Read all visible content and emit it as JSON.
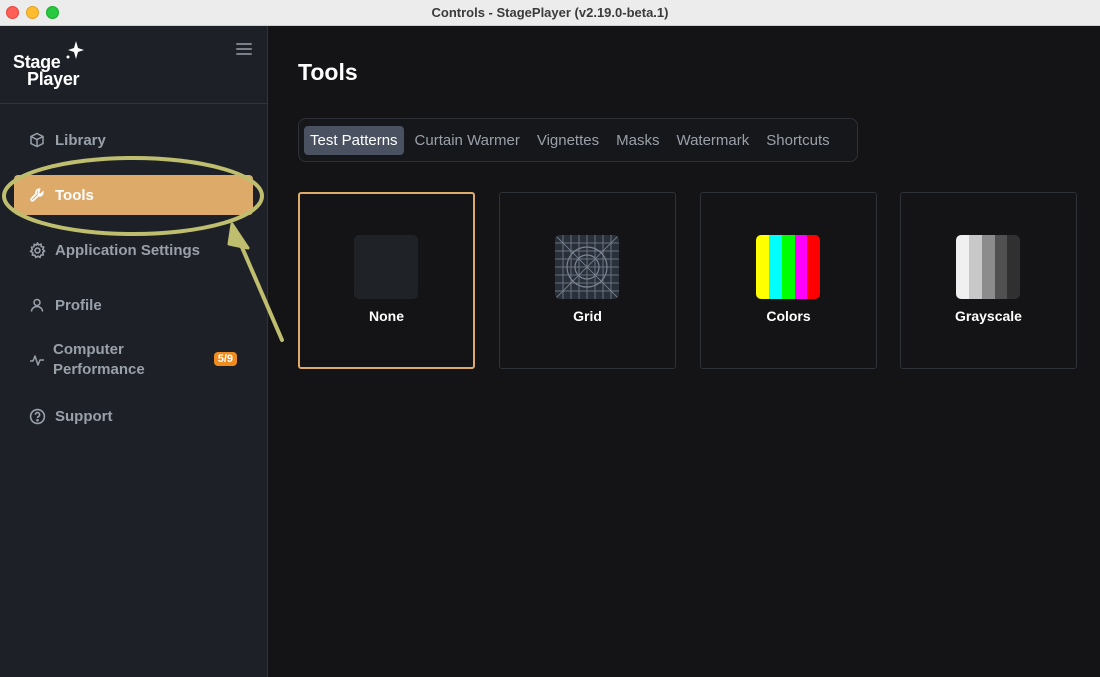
{
  "window": {
    "title": "Controls - StagePlayer (v2.19.0-beta.1)"
  },
  "sidebar": {
    "logo_line1": "Stage",
    "logo_line2": "Player",
    "items": [
      {
        "label": "Library",
        "icon": "cube-icon"
      },
      {
        "label": "Tools",
        "icon": "wrench-icon",
        "active": true
      },
      {
        "label": "Application Settings",
        "icon": "gear-icon"
      },
      {
        "label": "Profile",
        "icon": "user-icon"
      },
      {
        "label_line1": "Computer",
        "label_line2": "Performance",
        "icon": "activity-icon",
        "badge": "5/9"
      },
      {
        "label": "Support",
        "icon": "help-circle-icon"
      }
    ]
  },
  "main": {
    "title": "Tools",
    "tabs": [
      {
        "label": "Test Patterns",
        "active": true
      },
      {
        "label": "Curtain Warmer"
      },
      {
        "label": "Vignettes"
      },
      {
        "label": "Masks"
      },
      {
        "label": "Watermark"
      },
      {
        "label": "Shortcuts"
      }
    ],
    "patterns": [
      {
        "label": "None",
        "selected": true
      },
      {
        "label": "Grid"
      },
      {
        "label": "Colors"
      },
      {
        "label": "Grayscale"
      }
    ]
  },
  "colors": {
    "accent": "#ddaa6a",
    "badge": "#f08c1e",
    "annotation": "#bfbd6e",
    "color_bars": [
      "#ffff00",
      "#00ffff",
      "#00ff00",
      "#ff00ff",
      "#ff0000"
    ],
    "gray_bars": [
      "#f0f0f0",
      "#c8c8c8",
      "#8c8c8c",
      "#505050",
      "#303030"
    ]
  }
}
